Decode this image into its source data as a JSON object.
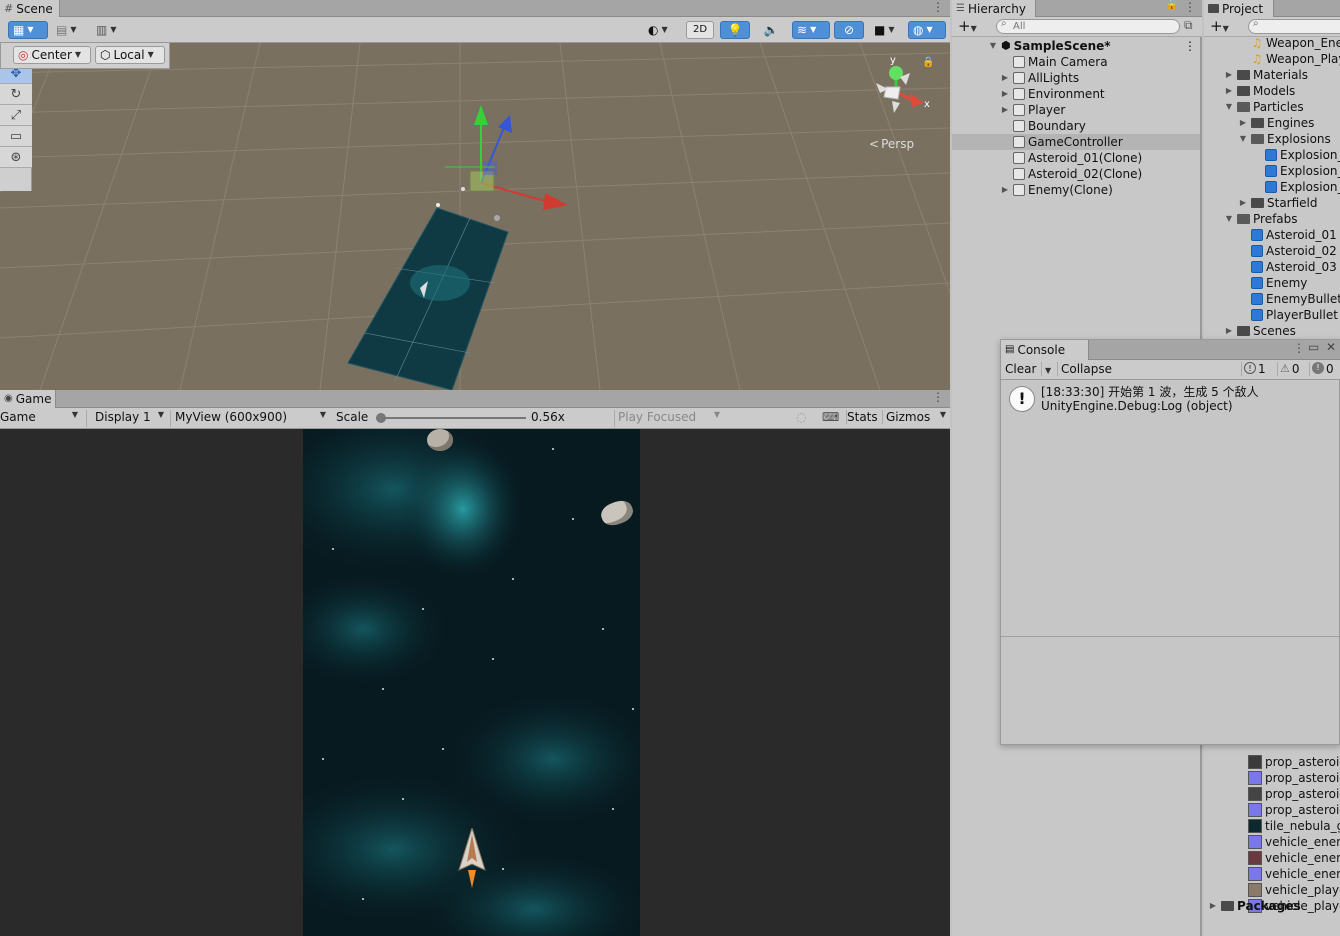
{
  "scene": {
    "tab": "Scene",
    "mode_2d": "2D",
    "pivot": "Center",
    "space": "Local",
    "persp": "Persp",
    "axis_y": "y",
    "axis_x": "x"
  },
  "game": {
    "tab": "Game",
    "dropdown": "Game",
    "display": "Display 1",
    "resolution": "MyView (600x900)",
    "scale_label": "Scale",
    "scale_value": "0.56x",
    "scale_fraction": 0.0,
    "play_mode": "Play Focused",
    "stats": "Stats",
    "gizmos": "Gizmos"
  },
  "hierarchy": {
    "tab": "Hierarchy",
    "search_placeholder": "All",
    "scene_name": "SampleScene*",
    "items": [
      {
        "label": "Main Camera",
        "expandable": false
      },
      {
        "label": "AllLights",
        "expandable": true
      },
      {
        "label": "Environment",
        "expandable": true
      },
      {
        "label": "Player",
        "expandable": true
      },
      {
        "label": "Boundary",
        "expandable": false
      },
      {
        "label": "GameController",
        "expandable": false,
        "selected": true
      },
      {
        "label": "Asteroid_01(Clone)",
        "expandable": false
      },
      {
        "label": "Asteroid_02(Clone)",
        "expandable": false
      },
      {
        "label": "Enemy(Clone)",
        "expandable": true
      }
    ]
  },
  "project": {
    "tab": "Project",
    "items_top": [
      {
        "label": "Weapon_Ener",
        "kind": "audio",
        "indent": 2
      },
      {
        "label": "Weapon_Playe",
        "kind": "audio",
        "indent": 2
      },
      {
        "label": "Materials",
        "kind": "folder",
        "indent": 1,
        "arrow": "right"
      },
      {
        "label": "Models",
        "kind": "folder",
        "indent": 1,
        "arrow": "right"
      },
      {
        "label": "Particles",
        "kind": "folder-open",
        "indent": 1,
        "arrow": "down"
      },
      {
        "label": "Engines",
        "kind": "folder",
        "indent": 2,
        "arrow": "right"
      },
      {
        "label": "Explosions",
        "kind": "folder-open",
        "indent": 2,
        "arrow": "down"
      },
      {
        "label": "Explosion_A",
        "kind": "prefab",
        "indent": 3
      },
      {
        "label": "Explosion_E",
        "kind": "prefab",
        "indent": 3
      },
      {
        "label": "Explosion_P",
        "kind": "prefab",
        "indent": 3
      },
      {
        "label": "Starfield",
        "kind": "folder",
        "indent": 2,
        "arrow": "right"
      },
      {
        "label": "Prefabs",
        "kind": "folder-open",
        "indent": 1,
        "arrow": "down"
      },
      {
        "label": "Asteroid_01",
        "kind": "prefab",
        "indent": 2
      },
      {
        "label": "Asteroid_02",
        "kind": "prefab",
        "indent": 2
      },
      {
        "label": "Asteroid_03",
        "kind": "prefab",
        "indent": 2
      },
      {
        "label": "Enemy",
        "kind": "prefab",
        "indent": 2
      },
      {
        "label": "EnemyBullet",
        "kind": "prefab",
        "indent": 2
      },
      {
        "label": "PlayerBullet",
        "kind": "prefab",
        "indent": 2
      },
      {
        "label": "Scenes",
        "kind": "folder",
        "indent": 1,
        "arrow": "right"
      }
    ],
    "items_bottom": [
      {
        "label": "prop_asteroid",
        "color": "#3b3b3b"
      },
      {
        "label": "prop_asteroid",
        "color": "#7a78e6"
      },
      {
        "label": "prop_asteroid",
        "color": "#444444"
      },
      {
        "label": "prop_asteroid",
        "color": "#7a78e6"
      },
      {
        "label": "tile_nebula_gr",
        "color": "#0c2a2e"
      },
      {
        "label": "vehicle_enem",
        "color": "#7a78e6"
      },
      {
        "label": "vehicle_enem",
        "color": "#6b3a40"
      },
      {
        "label": "vehicle_enem",
        "color": "#7a78e6"
      },
      {
        "label": "vehicle_playe",
        "color": "#8a7a6a"
      },
      {
        "label": "vehicle_playe",
        "color": "#7a78e6"
      }
    ],
    "packages": "Packages"
  },
  "console": {
    "tab": "Console",
    "clear": "Clear",
    "collapse": "Collapse",
    "count_log": "1",
    "count_warn": "0",
    "count_error": "0",
    "log_line1": "[18:33:30] 开始第 1 波，生成 5 个敌人",
    "log_line2": "UnityEngine.Debug:Log (object)"
  }
}
